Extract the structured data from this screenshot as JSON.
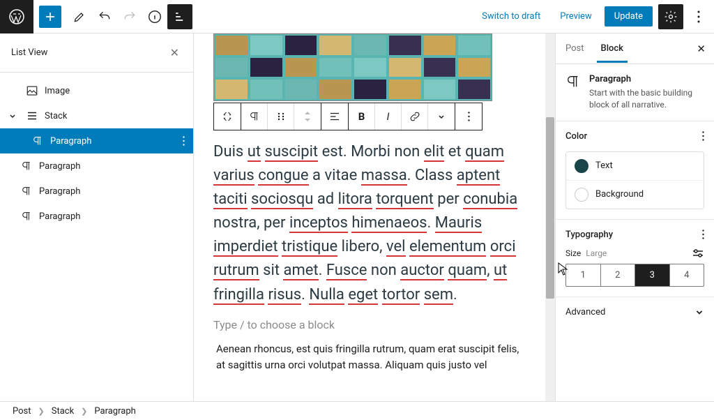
{
  "topbar": {
    "draft_label": "Switch to draft",
    "preview_label": "Preview",
    "update_label": "Update"
  },
  "list_view": {
    "title": "List View",
    "items": [
      {
        "label": "Image",
        "icon": "image"
      },
      {
        "label": "Stack",
        "icon": "stack",
        "expanded": true
      },
      {
        "label": "Paragraph",
        "icon": "paragraph",
        "selected": true,
        "depth": 2
      },
      {
        "label": "Paragraph",
        "icon": "paragraph",
        "depth": 1
      },
      {
        "label": "Paragraph",
        "icon": "paragraph",
        "depth": 1
      },
      {
        "label": "Paragraph",
        "icon": "paragraph",
        "depth": 1
      }
    ]
  },
  "editor": {
    "paragraph_text": "Duis ut suscipit est. Morbi non elit et quam varius congue a vitae massa. Class aptent taciti sociosqu ad litora torquent per conubia nostra, per inceptos himenaeos. Mauris imperdiet tristique libero, vel elementum orci rutrum sit amet. Fusce non auctor quam, ut fringilla risus. Nulla eget tortor sem.",
    "placeholder": "Type / to choose a block",
    "after_text": " Aenean rhoncus, est quis fringilla rutrum, quam erat suscipit felis, at sagittis urna orci volutpat massa. Aliquam quis justo vel"
  },
  "inspector": {
    "tabs": {
      "post": "Post",
      "block": "Block"
    },
    "block": {
      "title": "Paragraph",
      "description": "Start with the basic building block of all narrative."
    },
    "color": {
      "panel_title": "Color",
      "text_label": "Text",
      "background_label": "Background"
    },
    "typography": {
      "panel_title": "Typography",
      "size_label": "Size",
      "size_value": "Large",
      "options": [
        "1",
        "2",
        "3",
        "4"
      ],
      "selected_index": 2
    },
    "advanced": {
      "title": "Advanced"
    }
  },
  "breadcrumb": [
    "Post",
    "Stack",
    "Paragraph"
  ]
}
